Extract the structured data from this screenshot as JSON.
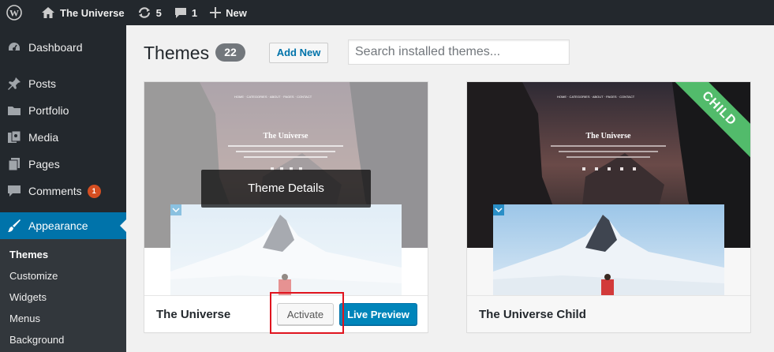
{
  "adminbar": {
    "wp_icon": "wordpress-logo-icon",
    "site_name": "The Universe",
    "updates_count": "5",
    "comments_count": "1",
    "new_label": "New"
  },
  "sidebar": {
    "items": [
      {
        "label": "Dashboard",
        "icon": "dashboard-icon"
      },
      {
        "label": "Posts",
        "icon": "pin-icon"
      },
      {
        "label": "Portfolio",
        "icon": "folder-icon"
      },
      {
        "label": "Media",
        "icon": "media-icon"
      },
      {
        "label": "Pages",
        "icon": "pages-icon"
      },
      {
        "label": "Comments",
        "icon": "comment-icon",
        "badge": "1"
      },
      {
        "label": "Appearance",
        "icon": "brush-icon"
      }
    ],
    "submenu": [
      "Themes",
      "Customize",
      "Widgets",
      "Menus",
      "Background"
    ]
  },
  "header": {
    "title": "Themes",
    "count": "22",
    "add_new": "Add New",
    "search_placeholder": "Search installed themes..."
  },
  "themes": [
    {
      "name": "The Universe",
      "details_label": "Theme Details",
      "activate_label": "Activate",
      "preview_label": "Live Preview",
      "preview_title": "The Universe"
    },
    {
      "name": "The Universe Child",
      "ribbon": "CHILD",
      "preview_title": "The Universe"
    }
  ],
  "colors": {
    "admin_dark": "#23282d",
    "accent_blue": "#0073aa",
    "child_green": "#52bb6b",
    "highlight_red": "#e0141e",
    "badge_orange": "#d54e21"
  }
}
